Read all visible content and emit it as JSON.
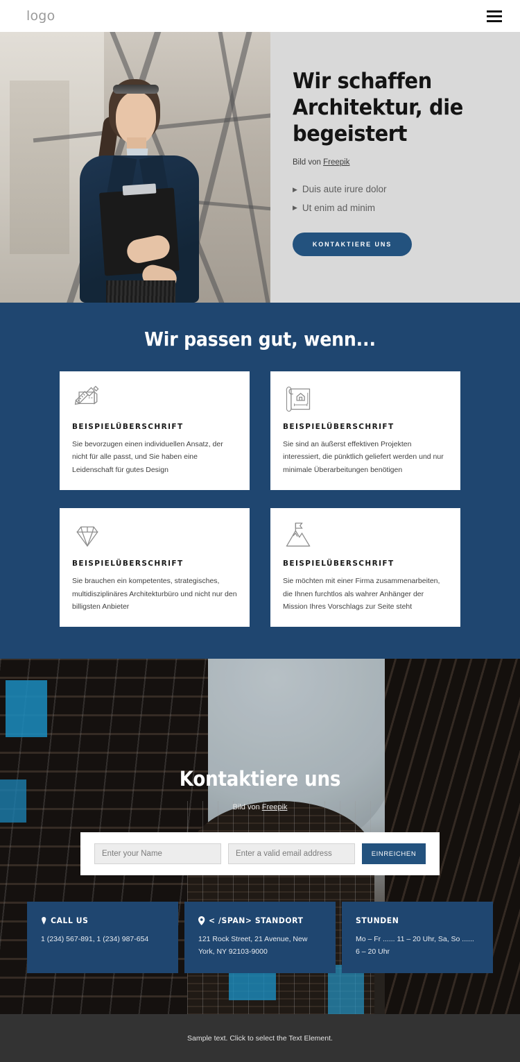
{
  "header": {
    "logo": "logo",
    "menu_icon": "hamburger-icon"
  },
  "hero": {
    "title": "Wir schaffen Architektur, die begeistert",
    "credit_prefix": "Bild von ",
    "credit_link": "Freepik",
    "bullets": [
      "Duis aute irure dolor",
      "Ut enim ad minim"
    ],
    "cta_label": "KONTAKTIERE UNS",
    "panel_bg": "#d9d9d9"
  },
  "features": {
    "heading": "Wir passen gut, wenn...",
    "bg": "#1f4670",
    "cards": [
      {
        "icon": "ruler-pencil-paper-icon",
        "title": "BEISPIELÜBERSCHRIFT",
        "text": "Sie bevorzugen einen individuellen Ansatz, der nicht für alle passt, und Sie haben eine Leidenschaft für gutes Design"
      },
      {
        "icon": "blueprint-house-icon",
        "title": "BEISPIELÜBERSCHRIFT",
        "text": "Sie sind an äußerst effektiven Projekten interessiert, die pünktlich geliefert werden und nur minimale Überarbeitungen benötigen"
      },
      {
        "icon": "diamond-icon",
        "title": "BEISPIELÜBERSCHRIFT",
        "text": "Sie brauchen ein kompetentes, strategisches, multidisziplinäres Architekturbüro und nicht nur den billigsten Anbieter"
      },
      {
        "icon": "mountain-flag-icon",
        "title": "BEISPIELÜBERSCHRIFT",
        "text": "Sie möchten mit einer Firma zusammenarbeiten, die Ihnen furchtlos als wahrer Anhänger der Mission Ihres Vorschlags zur Seite steht"
      }
    ]
  },
  "contact": {
    "heading": "Kontaktiere uns",
    "credit_prefix": "Bild von ",
    "credit_link": "Freepik",
    "form": {
      "name_placeholder": "Enter your Name",
      "name_value": "",
      "email_placeholder": "Enter a valid email address",
      "email_value": "",
      "submit_label": "EINREICHEN"
    },
    "info": [
      {
        "icon": "phone-icon",
        "title": "CALL US",
        "text": "1 (234) 567-891, 1 (234) 987-654"
      },
      {
        "icon": "location-pin-icon",
        "title": "< /SPAN> STANDORT",
        "text": "121 Rock Street, 21 Avenue, New York, NY 92103-9000"
      },
      {
        "icon": "none",
        "title": "STUNDEN",
        "text": "Mo – Fr ...... 11 – 20 Uhr, Sa, So  ...... 6 – 20 Uhr"
      }
    ]
  },
  "footer": {
    "text": "Sample text. Click to select the Text Element."
  },
  "colors": {
    "brand_blue": "#1f4670",
    "button_blue": "#23527e",
    "footer_gray": "#333333"
  }
}
